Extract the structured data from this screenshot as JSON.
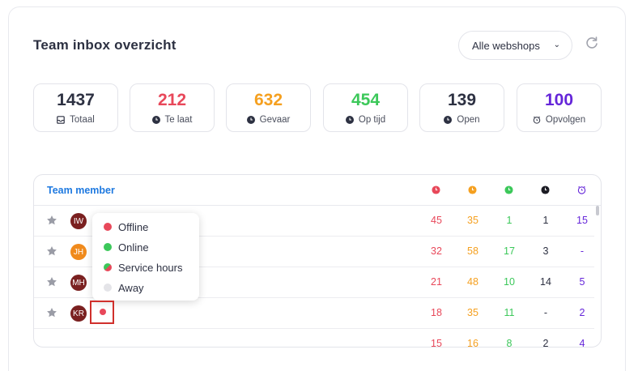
{
  "header": {
    "title": "Team inbox overzicht",
    "shop_select": "Alle webshops",
    "refresh_icon": "refresh-icon"
  },
  "colors": {
    "red": "#e8485a",
    "orange": "#f5a020",
    "green": "#3cc85a",
    "dark": "#2d3142",
    "purple": "#6526d9",
    "blue": "#1f7ae0"
  },
  "stats": [
    {
      "value": "1437",
      "label": "Totaal",
      "icon": "inbox-icon",
      "color": "#2d3142"
    },
    {
      "value": "212",
      "label": "Te laat",
      "icon": "clock-icon",
      "color": "#e8485a"
    },
    {
      "value": "632",
      "label": "Gevaar",
      "icon": "clock-icon",
      "color": "#f5a020"
    },
    {
      "value": "454",
      "label": "Op tijd",
      "icon": "clock-icon",
      "color": "#3cc85a"
    },
    {
      "value": "139",
      "label": "Open",
      "icon": "clock-icon",
      "color": "#2d3142"
    },
    {
      "value": "100",
      "label": "Opvolgen",
      "icon": "alarm-icon",
      "color": "#6526d9"
    }
  ],
  "table": {
    "member_header": "Team member",
    "column_icons": [
      "clock-red-icon",
      "clock-orange-icon",
      "clock-green-icon",
      "clock-dark-icon",
      "alarm-purple-icon"
    ],
    "rows": [
      {
        "initials": "IW",
        "avatar_color": "#7a2020",
        "values": [
          "45",
          "35",
          "1",
          "1",
          "15"
        ]
      },
      {
        "initials": "JH",
        "avatar_color": "#f08a1c",
        "values": [
          "32",
          "58",
          "17",
          "3",
          "-"
        ]
      },
      {
        "initials": "MH",
        "avatar_color": "#7a2020",
        "values": [
          "21",
          "48",
          "10",
          "14",
          "5"
        ]
      },
      {
        "initials": "KR",
        "avatar_color": "#7a2020",
        "values": [
          "18",
          "35",
          "11",
          "-",
          "2"
        ]
      },
      {
        "initials": "",
        "avatar_color": "",
        "values": [
          "15",
          "16",
          "8",
          "2",
          "4"
        ]
      }
    ]
  },
  "status_popup": {
    "options": [
      {
        "label": "Offline",
        "color": "#e8485a"
      },
      {
        "label": "Online",
        "color": "#3cc85a"
      },
      {
        "label": "Service hours",
        "color": "split"
      },
      {
        "label": "Away",
        "color": "#e4e4e8"
      }
    ]
  }
}
